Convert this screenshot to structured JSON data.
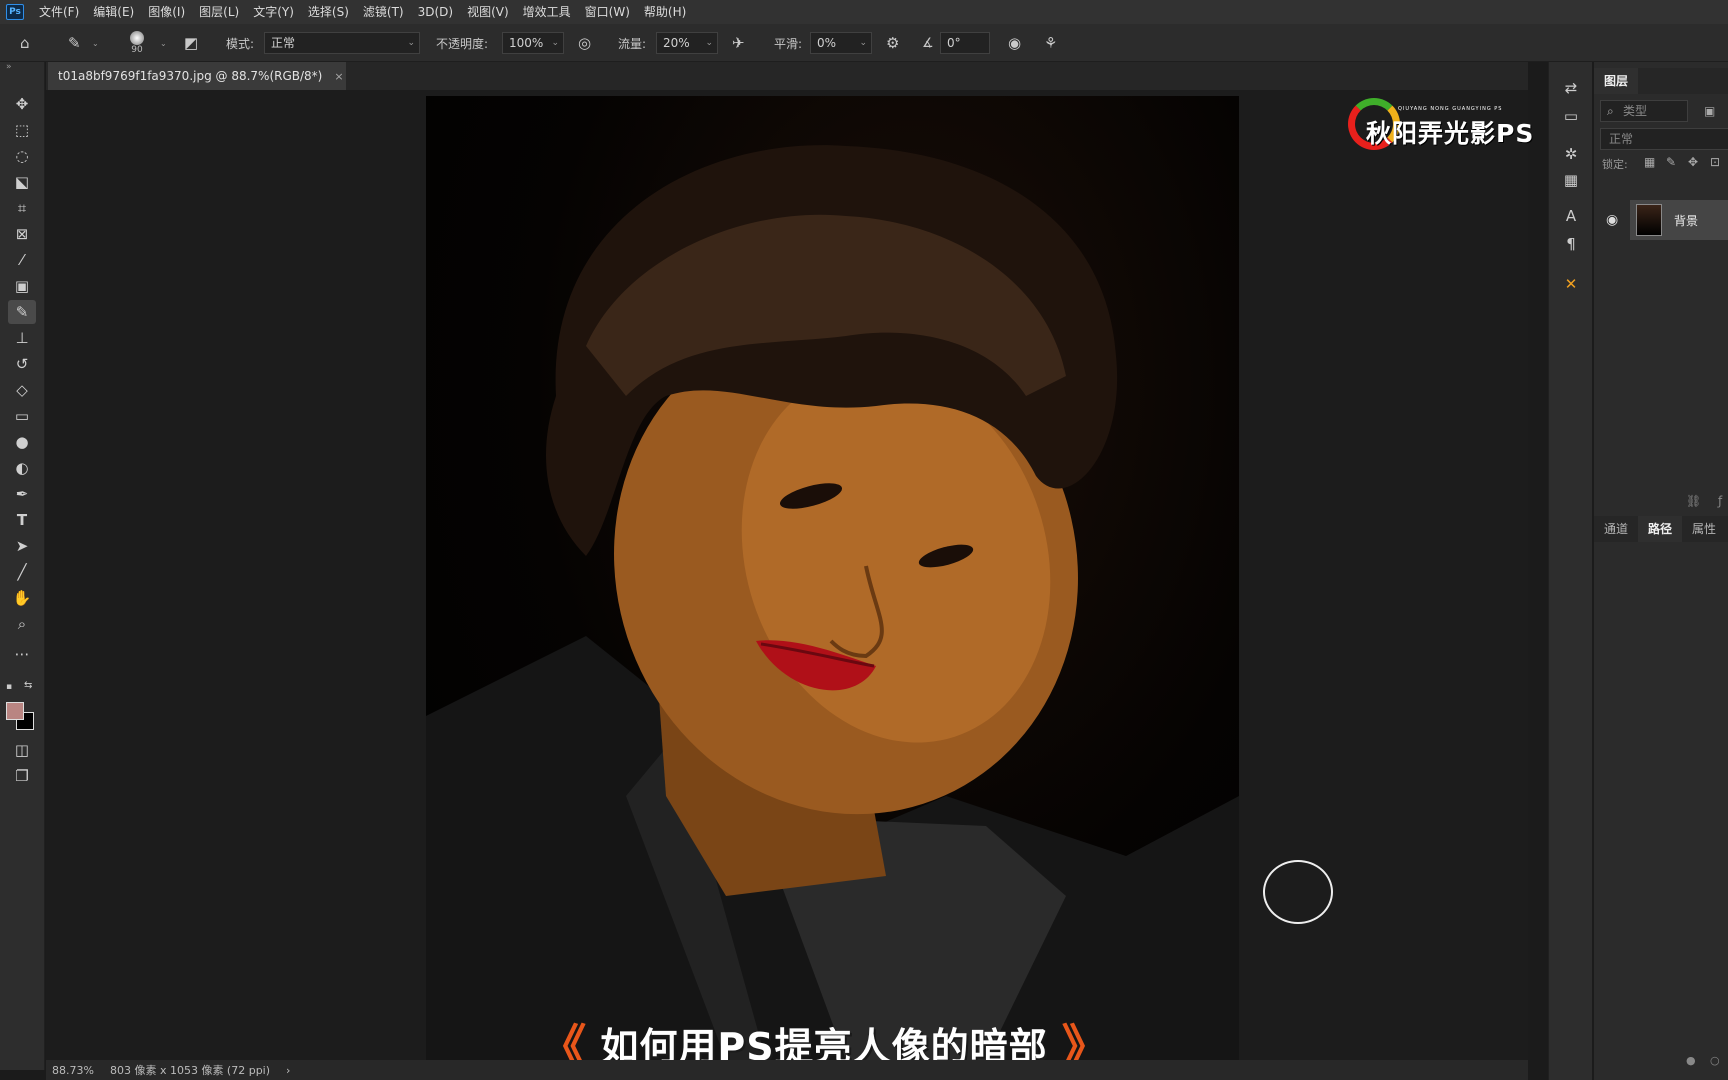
{
  "menubar": {
    "logo": "Ps",
    "items": [
      "文件(F)",
      "编辑(E)",
      "图像(I)",
      "图层(L)",
      "文字(Y)",
      "选择(S)",
      "滤镜(T)",
      "3D(D)",
      "视图(V)",
      "增效工具",
      "窗口(W)",
      "帮助(H)"
    ]
  },
  "options": {
    "brush_size": "90",
    "mode_label": "模式:",
    "mode_value": "正常",
    "opacity_label": "不透明度:",
    "opacity_value": "100%",
    "flow_label": "流量:",
    "flow_value": "20%",
    "smoothing_label": "平滑:",
    "smoothing_value": "0%",
    "angle_value": "0°"
  },
  "document": {
    "tab_title": "t01a8bf9769f1fa9370.jpg @ 88.7%(RGB/8*)",
    "close": "×"
  },
  "overlay": {
    "subtitle_left": "《",
    "subtitle": "如何用PS提亮人像的暗部",
    "subtitle_right": "》",
    "watermark_small": "QIUYANG NONG GUANGYING PS",
    "watermark_big": "秋阳弄光影PS"
  },
  "status": {
    "zoom": "88.73%",
    "dimensions": "803 像素 x 1053 像素 (72 ppi)",
    "arrow": "›"
  },
  "layers_panel": {
    "tab_layers": "图层",
    "search_placeholder": "类型",
    "blend_mode": "正常",
    "lock_label": "锁定:",
    "layer_name": "背景"
  },
  "bottom_panel": {
    "tabs": [
      "通道",
      "路径",
      "属性"
    ],
    "active_tab": "路径"
  },
  "colors": {
    "foreground": "#b98582",
    "background": "#000000",
    "accent": "#e8561a"
  }
}
